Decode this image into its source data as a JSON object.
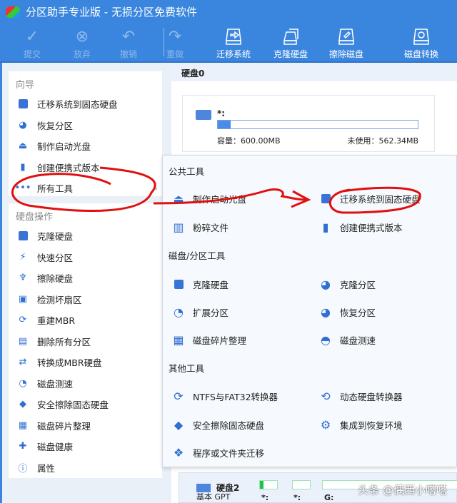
{
  "window": {
    "title": "分区助手专业版 - 无损分区免费软件"
  },
  "toolbar": {
    "items": [
      {
        "label": "提交",
        "disabled": true
      },
      {
        "label": "放弃",
        "disabled": true
      },
      {
        "label": "撤销",
        "disabled": true
      },
      {
        "label": "重做",
        "disabled": true
      },
      {
        "label": "迁移系统"
      },
      {
        "label": "克隆硬盘"
      },
      {
        "label": "擦除磁盘"
      },
      {
        "label": "磁盘转换"
      }
    ]
  },
  "sidebar": {
    "wizard_header": "向导",
    "wizard": [
      "迁移系统到固态硬盘",
      "恢复分区",
      "制作启动光盘",
      "创建便携式版本",
      "所有工具"
    ],
    "disk_ops_header": "硬盘操作",
    "disk_ops": [
      "克隆硬盘",
      "快速分区",
      "擦除硬盘",
      "检测坏扇区",
      "重建MBR",
      "删除所有分区",
      "转换成MBR硬盘",
      "磁盘测速",
      "安全擦除固态硬盘",
      "磁盘碎片整理",
      "磁盘健康",
      "属性"
    ]
  },
  "main": {
    "disk0_header": "硬盘0",
    "partition_label": "*:",
    "used_percent": 6.3,
    "capacity": "容量：600.00MB",
    "unused": "未使用：562.34MB",
    "disk2": {
      "label": "硬盘2",
      "partitions": [
        "*:",
        "*:",
        "G:"
      ],
      "type_partial": "基本 GPT"
    }
  },
  "popup": {
    "public_header": "公共工具",
    "public": [
      "制作启动光盘",
      "迁移系统到固态硬盘",
      "粉碎文件",
      "创建便携式版本"
    ],
    "disk_header": "磁盘/分区工具",
    "disk": [
      "克隆硬盘",
      "克隆分区",
      "扩展分区",
      "恢复分区",
      "磁盘碎片整理",
      "磁盘测速"
    ],
    "other_header": "其他工具",
    "other": [
      "NTFS与FAT32转换器",
      "动态硬盘转换器",
      "安全擦除固态硬盘",
      "集成到恢复环境",
      "程序或文件夹迁移"
    ]
  },
  "watermark": "头条 @偶西小嗒嗒",
  "colors": {
    "accent": "#3a86de",
    "annotation": "#e01010"
  }
}
